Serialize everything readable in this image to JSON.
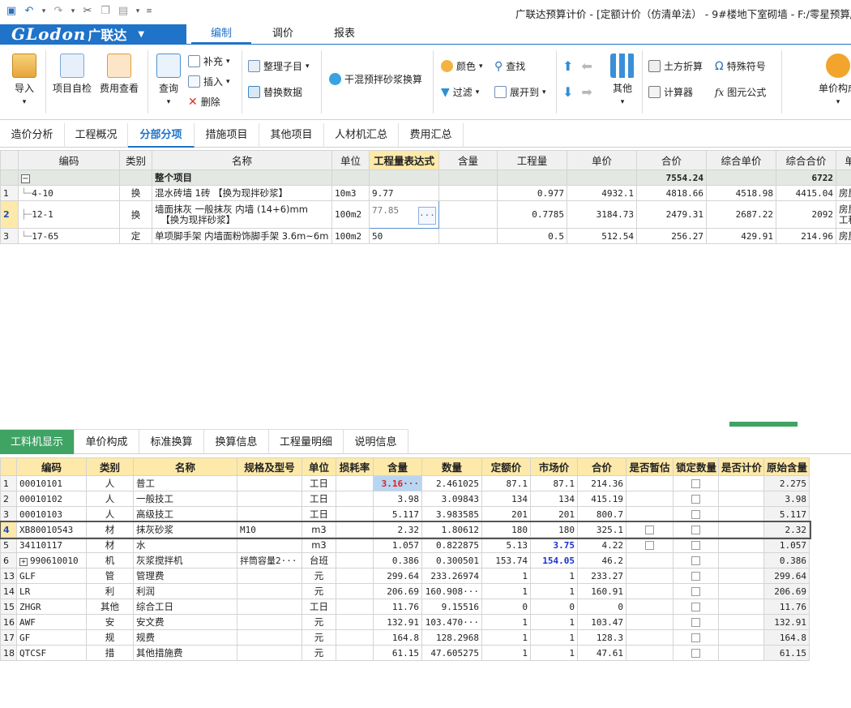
{
  "window_title": "广联达预算计价 - [定额计价（仿清单法） - 9#楼地下室砌墙 - F:/零星预算/9#",
  "brand": {
    "logo": "GLodon",
    "cn": "广联达"
  },
  "menu_tabs": [
    "编制",
    "调价",
    "报表"
  ],
  "ribbon": {
    "import": "导入",
    "self_check": "项目自检",
    "fee_view": "费用查看",
    "query": "查询",
    "supplement": "补充",
    "insert": "插入",
    "delete": "删除",
    "organize": "整理子目",
    "replace_data": "替换数据",
    "mortar_convert": "干混预拌砂浆换算",
    "color": "颜色",
    "filter": "过滤",
    "find": "查找",
    "expand": "展开到",
    "other": "其他",
    "earth_calc": "土方折算",
    "special_char": "特殊符号",
    "calculator": "计算器",
    "figure_formula": "图元公式",
    "unit_price_comp": "单价构成"
  },
  "main_tabs": [
    "造价分析",
    "工程概况",
    "分部分项",
    "措施项目",
    "其他项目",
    "人材机汇总",
    "费用汇总"
  ],
  "upper_table": {
    "headers": [
      "编码",
      "类别",
      "名称",
      "单位",
      "工程量表达式",
      "含量",
      "工程量",
      "单价",
      "合价",
      "综合单价",
      "综合合价",
      "单价构"
    ],
    "group_row": {
      "expand": "−",
      "name": "整个项目",
      "total": "7554.24",
      "comp_total": "6722"
    },
    "rows": [
      {
        "no": "1",
        "code": "4-10",
        "type": "换",
        "name": "混水砖墙 1砖 【换为现拌砂浆】",
        "unit": "10m3",
        "expr": "9.77",
        "content": "",
        "qty": "0.977",
        "price": "4932.1",
        "total": "4818.66",
        "comp_price": "4518.98",
        "comp_total": "4415.04",
        "pc": "房屋建筑"
      },
      {
        "no": "2",
        "code": "12-1",
        "type": "换",
        "name": "墙面抹灰 一般抹灰 内墙 (14+6)mm",
        "name2": "【换为现拌砂浆】",
        "unit": "100m2",
        "expr": "77.85",
        "expr_btn": "···",
        "content": "",
        "qty": "0.7785",
        "price": "3184.73",
        "total": "2479.31",
        "comp_price": "2687.22",
        "comp_total": "2092",
        "pc": "房屋建筑",
        "pc2": "工程"
      },
      {
        "no": "3",
        "code": "17-65",
        "type": "定",
        "name": "单项脚手架 内墙面粉饰脚手架 3.6m~6m",
        "unit": "100m2",
        "expr": "50",
        "content": "",
        "qty": "0.5",
        "price": "512.54",
        "total": "256.27",
        "comp_price": "429.91",
        "comp_total": "214.96",
        "pc": "房屋建筑"
      }
    ]
  },
  "lower_tabs": [
    "工料机显示",
    "单价构成",
    "标准换算",
    "换算信息",
    "工程量明细",
    "说明信息"
  ],
  "lower_table": {
    "headers": [
      "编码",
      "类别",
      "名称",
      "规格及型号",
      "单位",
      "损耗率",
      "含量",
      "数量",
      "定额价",
      "市场价",
      "合价",
      "是否暂估",
      "锁定数量",
      "是否计价",
      "原始含量"
    ],
    "rows": [
      {
        "no": "1",
        "code": "00010101",
        "type": "人",
        "name": "普工",
        "spec": "",
        "unit": "工日",
        "loss": "",
        "content": "3.16···",
        "qty": "2.461025",
        "quota": "87.1",
        "market": "87.1",
        "total": "214.36",
        "est": false,
        "lock": true,
        "price_flag": false,
        "orig": "2.275"
      },
      {
        "no": "2",
        "code": "00010102",
        "type": "人",
        "name": "一般技工",
        "spec": "",
        "unit": "工日",
        "loss": "",
        "content": "3.98",
        "qty": "3.09843",
        "quota": "134",
        "market": "134",
        "total": "415.19",
        "est": false,
        "lock": true,
        "price_flag": false,
        "orig": "3.98"
      },
      {
        "no": "3",
        "code": "00010103",
        "type": "人",
        "name": "高级技工",
        "spec": "",
        "unit": "工日",
        "loss": "",
        "content": "5.117",
        "qty": "3.983585",
        "quota": "201",
        "market": "201",
        "total": "800.7",
        "est": false,
        "lock": true,
        "price_flag": false,
        "orig": "5.117"
      },
      {
        "no": "4",
        "code": "XB80010543",
        "type": "材",
        "name": "抹灰砂浆",
        "spec": "M10",
        "unit": "m3",
        "loss": "",
        "content": "2.32",
        "qty": "1.80612",
        "quota": "180",
        "market": "180",
        "total": "325.1",
        "est": true,
        "lock": true,
        "price_flag": false,
        "orig": "2.32"
      },
      {
        "no": "5",
        "code": "34110117",
        "type": "材",
        "name": "水",
        "spec": "",
        "unit": "m3",
        "loss": "",
        "content": "1.057",
        "qty": "0.822875",
        "quota": "5.13",
        "market": "3.75",
        "total": "4.22",
        "est": true,
        "lock": true,
        "price_flag": false,
        "orig": "1.057"
      },
      {
        "no": "6",
        "code": "990610010",
        "type": "机",
        "name": "灰浆搅拌机",
        "spec": "拌筒容量2···",
        "unit": "台班",
        "loss": "",
        "content": "0.386",
        "qty": "0.300501",
        "quota": "153.74",
        "market": "154.05",
        "total": "46.2",
        "est": false,
        "lock": true,
        "price_flag": false,
        "orig": "0.386"
      },
      {
        "no": "13",
        "code": "GLF",
        "type": "管",
        "name": "管理费",
        "spec": "",
        "unit": "元",
        "loss": "",
        "content": "299.64",
        "qty": "233.26974",
        "quota": "1",
        "market": "1",
        "total": "233.27",
        "est": false,
        "lock": true,
        "price_flag": false,
        "orig": "299.64"
      },
      {
        "no": "14",
        "code": "LR",
        "type": "利",
        "name": "利润",
        "spec": "",
        "unit": "元",
        "loss": "",
        "content": "206.69",
        "qty": "160.908···",
        "quota": "1",
        "market": "1",
        "total": "160.91",
        "est": false,
        "lock": true,
        "price_flag": false,
        "orig": "206.69"
      },
      {
        "no": "15",
        "code": "ZHGR",
        "type": "其他",
        "name": "综合工日",
        "spec": "",
        "unit": "工日",
        "loss": "",
        "content": "11.76",
        "qty": "9.15516",
        "quota": "0",
        "market": "0",
        "total": "0",
        "est": false,
        "lock": true,
        "price_flag": false,
        "orig": "11.76"
      },
      {
        "no": "16",
        "code": "AWF",
        "type": "安",
        "name": "安文费",
        "spec": "",
        "unit": "元",
        "loss": "",
        "content": "132.91",
        "qty": "103.470···",
        "quota": "1",
        "market": "1",
        "total": "103.47",
        "est": false,
        "lock": true,
        "price_flag": false,
        "orig": "132.91"
      },
      {
        "no": "17",
        "code": "GF",
        "type": "规",
        "name": "规费",
        "spec": "",
        "unit": "元",
        "loss": "",
        "content": "164.8",
        "qty": "128.2968",
        "quota": "1",
        "market": "1",
        "total": "128.3",
        "est": false,
        "lock": true,
        "price_flag": false,
        "orig": "164.8"
      },
      {
        "no": "18",
        "code": "QTCSF",
        "type": "措",
        "name": "其他措施费",
        "spec": "",
        "unit": "元",
        "loss": "",
        "content": "61.15",
        "qty": "47.605275",
        "quota": "1",
        "market": "1",
        "total": "47.61",
        "est": false,
        "lock": true,
        "price_flag": false,
        "orig": "61.15"
      }
    ]
  },
  "colors": {
    "brand_blue": "#1f73c8",
    "tab_green": "#3fa364",
    "red_value": "#e02020",
    "blue_value": "#1a2fd0",
    "header_yellow": "#fde9a9"
  }
}
